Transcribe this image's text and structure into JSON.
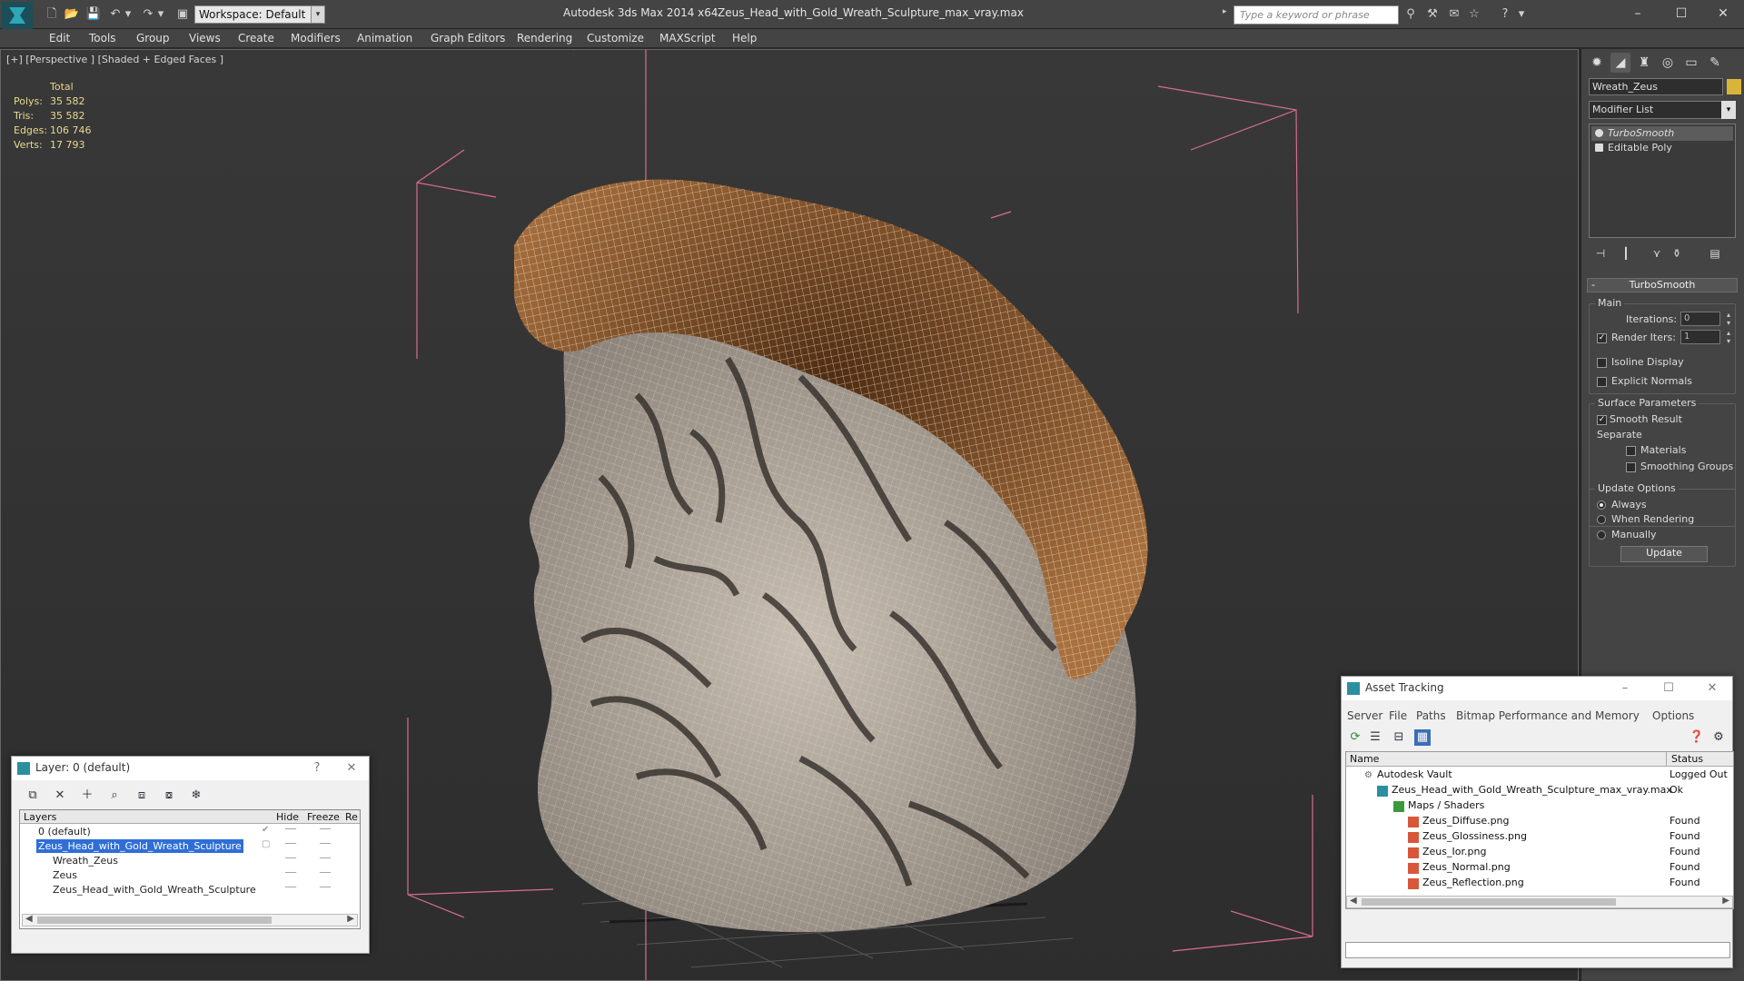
{
  "titlebar": {
    "workspace": "Workspace: Default",
    "app_title": "Autodesk 3ds Max  2014 x64",
    "file_title": "Zeus_Head_with_Gold_Wreath_Sculpture_max_vray.max",
    "search_placeholder": "Type a keyword or phrase"
  },
  "menu": [
    "Edit",
    "Tools",
    "Group",
    "Views",
    "Create",
    "Modifiers",
    "Animation",
    "Graph Editors",
    "Rendering",
    "Customize",
    "MAXScript",
    "Help"
  ],
  "viewport": {
    "label": "[+] [Perspective ] [Shaded + Edged Faces ]",
    "stats": {
      "header": "Total",
      "rows": [
        {
          "k": "Polys:",
          "v": "35 582"
        },
        {
          "k": "Tris:",
          "v": "35 582"
        },
        {
          "k": "Edges:",
          "v": "106 746"
        },
        {
          "k": "Verts:",
          "v": "17 793"
        }
      ]
    }
  },
  "command_panel": {
    "object_name": "Wreath_Zeus",
    "object_color": "#d9b43a",
    "modifier_list": "Modifier List",
    "stack": [
      "TurboSmooth",
      "Editable Poly"
    ],
    "rollout_title": "TurboSmooth",
    "main_group": "Main",
    "iterations_label": "Iterations:",
    "iterations_value": "0",
    "render_iters_label": "Render Iters:",
    "render_iters_value": "1",
    "isoline": "Isoline Display",
    "explicit": "Explicit Normals",
    "surface_group": "Surface Parameters",
    "smooth_result": "Smooth Result",
    "separate": "Separate",
    "materials": "Materials",
    "smoothing_groups": "Smoothing Groups",
    "update_group": "Update Options",
    "always": "Always",
    "when_rendering": "When Rendering",
    "manually": "Manually",
    "update_btn": "Update"
  },
  "layer_dialog": {
    "title": "Layer: 0 (default)",
    "help": "?",
    "columns": {
      "layers": "Layers",
      "hide": "Hide",
      "freeze": "Freeze",
      "re": "Re"
    },
    "rows": [
      {
        "name": "0 (default)",
        "indent": 0
      },
      {
        "name": "Zeus_Head_with_Gold_Wreath_Sculpture",
        "indent": 0
      },
      {
        "name": "Wreath_Zeus",
        "indent": 1
      },
      {
        "name": "Zeus",
        "indent": 1
      },
      {
        "name": "Zeus_Head_with_Gold_Wreath_Sculpture",
        "indent": 1
      }
    ]
  },
  "asset_tracking": {
    "title": "Asset Tracking",
    "menu": [
      "Server",
      "File",
      "Paths",
      "Bitmap Performance and Memory",
      "Options"
    ],
    "columns": {
      "name": "Name",
      "status": "Status"
    },
    "rows": [
      {
        "name": "Autodesk Vault",
        "status": "Logged Out",
        "level": 0
      },
      {
        "name": "Zeus_Head_with_Gold_Wreath_Sculpture_max_vray.max",
        "status": "Ok",
        "level": 1
      },
      {
        "name": "Maps / Shaders",
        "status": "",
        "level": 2
      },
      {
        "name": "Zeus_Diffuse.png",
        "status": "Found",
        "level": 3
      },
      {
        "name": "Zeus_Glossiness.png",
        "status": "Found",
        "level": 3
      },
      {
        "name": "Zeus_Ior.png",
        "status": "Found",
        "level": 3
      },
      {
        "name": "Zeus_Normal.png",
        "status": "Found",
        "level": 3
      },
      {
        "name": "Zeus_Reflection.png",
        "status": "Found",
        "level": 3
      }
    ]
  }
}
